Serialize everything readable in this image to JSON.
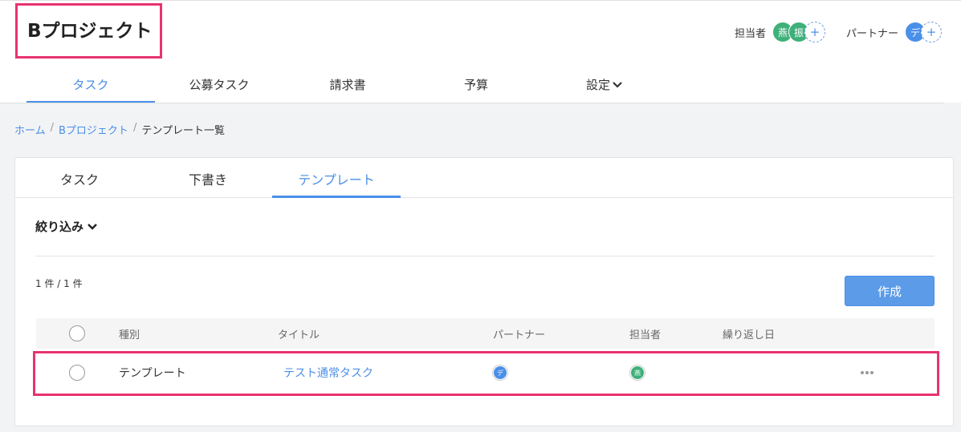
{
  "project": {
    "title": "Bプロジェクト"
  },
  "people": {
    "assignee_label": "担当者",
    "assignees": [
      "燕",
      "振"
    ],
    "partner_label": "パートナー",
    "partners": [
      "デ"
    ],
    "add_symbol": "+"
  },
  "nav": {
    "items": [
      {
        "label": "タスク",
        "active": true
      },
      {
        "label": "公募タスク"
      },
      {
        "label": "請求書"
      },
      {
        "label": "予算"
      },
      {
        "label": "設定"
      }
    ]
  },
  "breadcrumb": {
    "items": [
      "ホーム",
      "Bプロジェクト",
      "テンプレート一覧"
    ],
    "separator": "/"
  },
  "tabs": [
    {
      "label": "タスク"
    },
    {
      "label": "下書き"
    },
    {
      "label": "テンプレート",
      "active": true
    }
  ],
  "filter": {
    "label": "絞り込み"
  },
  "count": {
    "text": "1 件 / 1 件"
  },
  "create_button": {
    "label": "作成"
  },
  "table": {
    "columns": [
      "種別",
      "タイトル",
      "パートナー",
      "担当者",
      "繰り返し日"
    ],
    "rows": [
      {
        "type": "テンプレート",
        "title": "テスト通常タスク",
        "partner": "デ",
        "assignee": "燕",
        "repeat": ""
      }
    ]
  },
  "colors": {
    "accent": "#4a8fe8",
    "highlight": "#e8336e",
    "avatar_green": "#3fb07a"
  }
}
